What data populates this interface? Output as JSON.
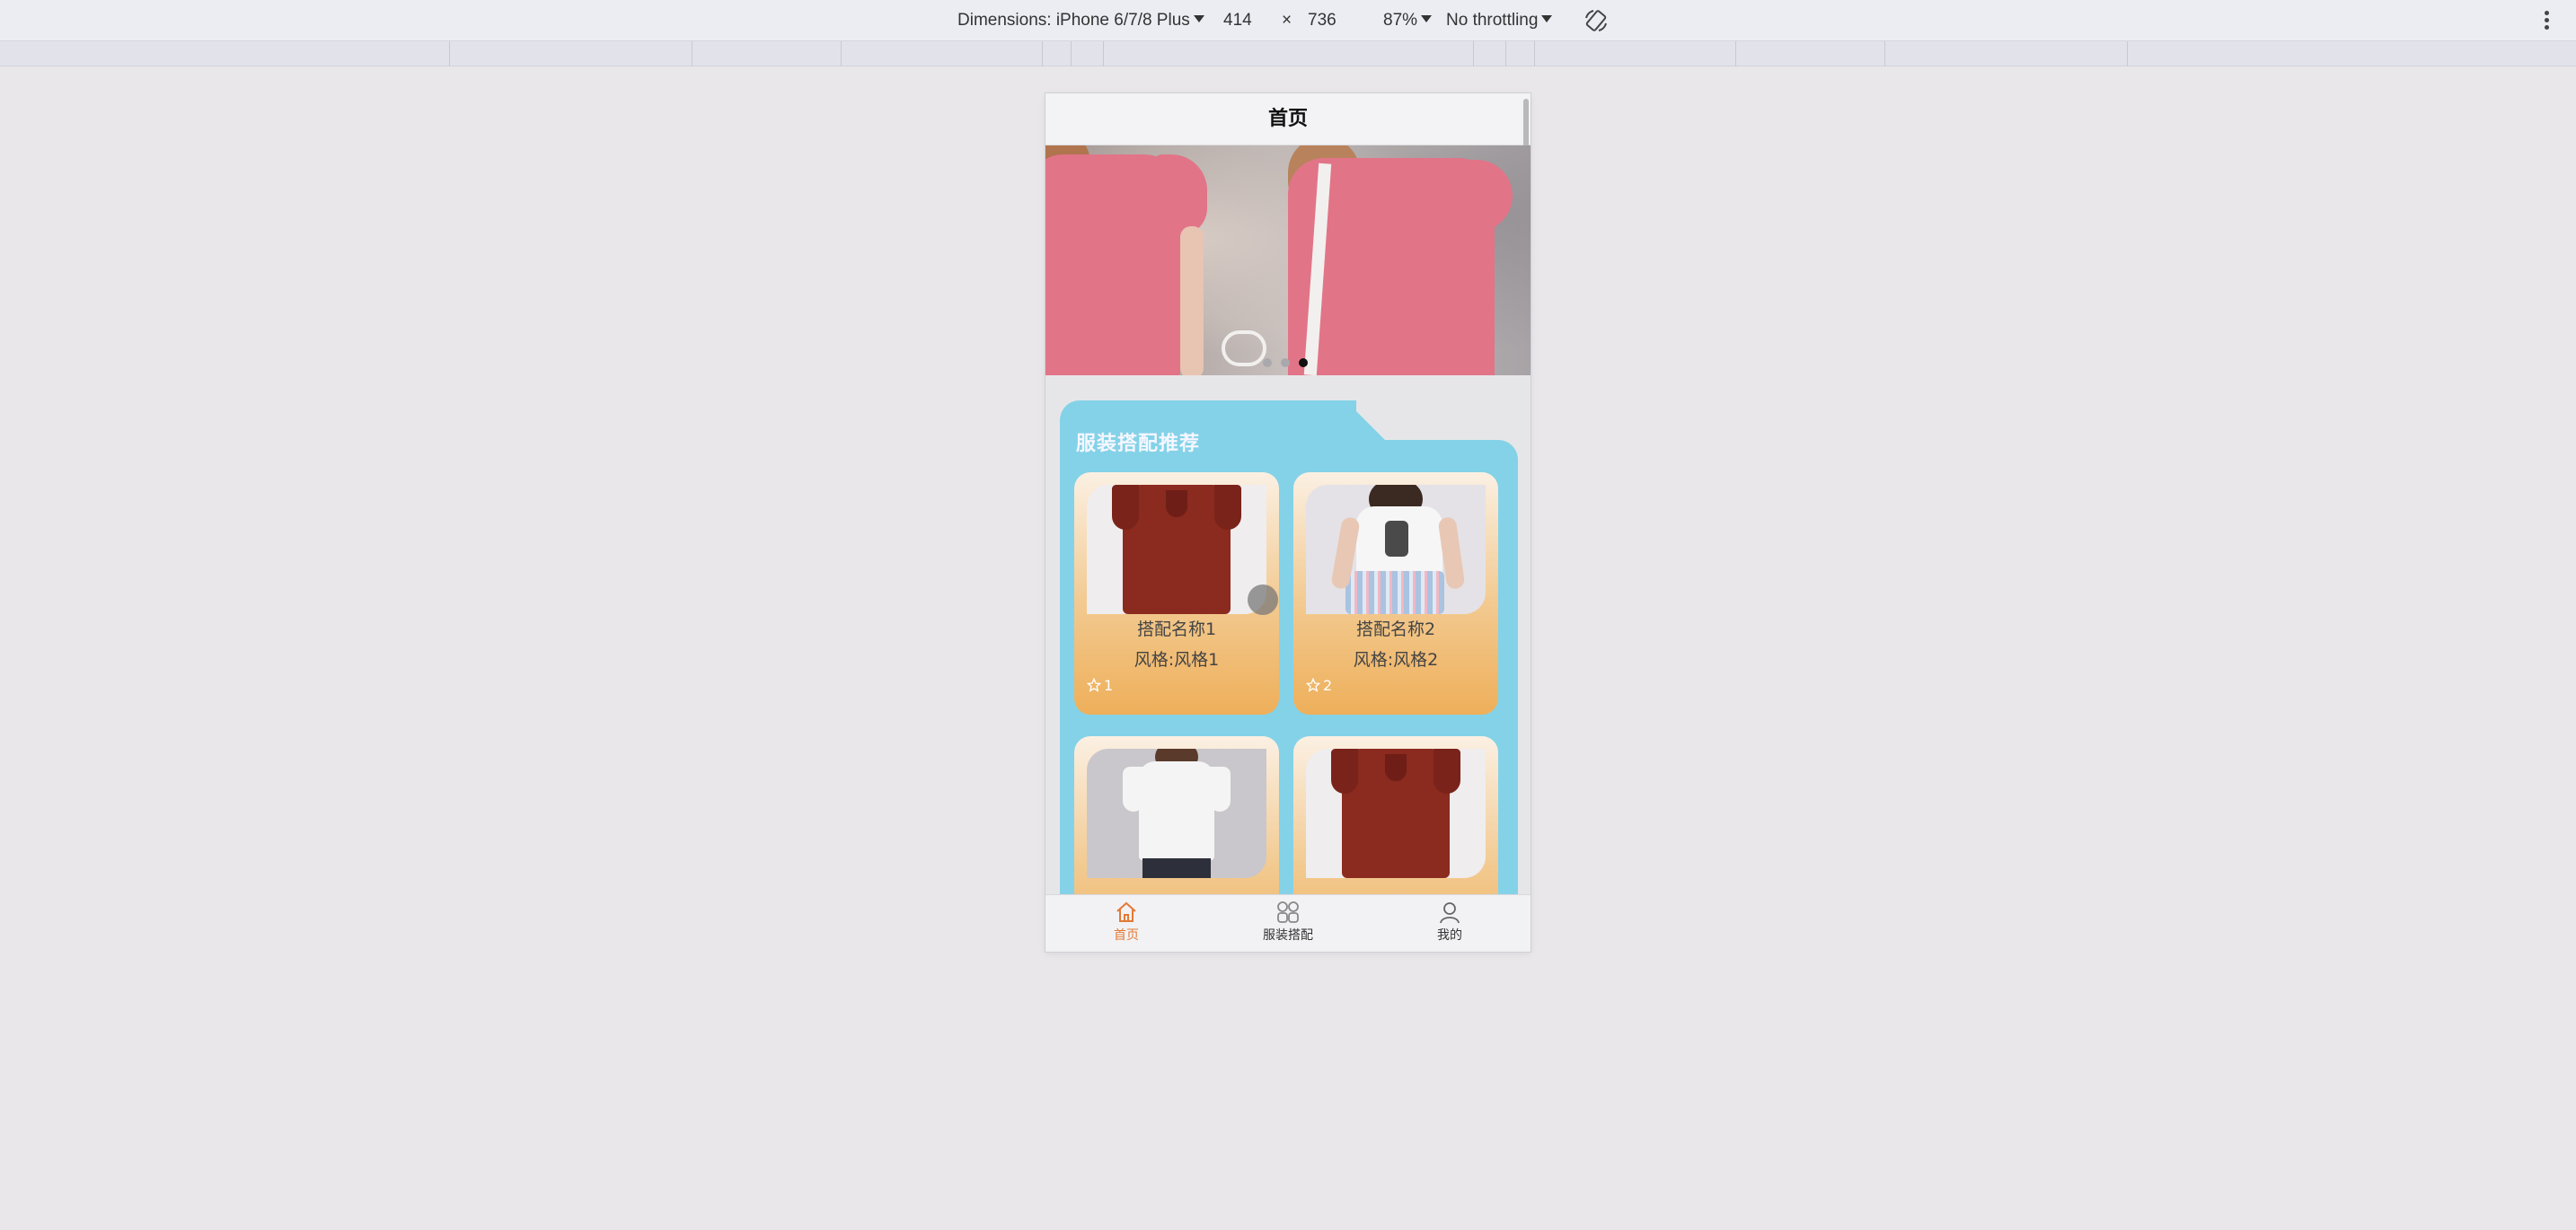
{
  "devtools": {
    "dimensions_label": "Dimensions: iPhone 6/7/8 Plus",
    "width": "414",
    "times": "×",
    "height": "736",
    "zoom": "87%",
    "throttling": "No throttling",
    "rotate_icon": "rotate-icon",
    "more_icon": "kebab-icon"
  },
  "page": {
    "title": "首页"
  },
  "banner": {
    "slide_count": 3,
    "active_index": 2
  },
  "recommend": {
    "title": "服装搭配推荐",
    "panel_color": "#84d2e8",
    "cards": [
      {
        "name": "搭配名称1",
        "style": "风格:风格1",
        "favorites": "1"
      },
      {
        "name": "搭配名称2",
        "style": "风格:风格2",
        "favorites": "2"
      },
      {
        "name": "",
        "style": "",
        "favorites": ""
      },
      {
        "name": "",
        "style": "",
        "favorites": ""
      }
    ]
  },
  "tabbar": {
    "accent": "#e27a36",
    "items": [
      {
        "label": "首页",
        "icon": "home-icon",
        "active": true
      },
      {
        "label": "服装搭配",
        "icon": "grid-icon",
        "active": false
      },
      {
        "label": "我的",
        "icon": "user-icon",
        "active": false
      }
    ]
  }
}
